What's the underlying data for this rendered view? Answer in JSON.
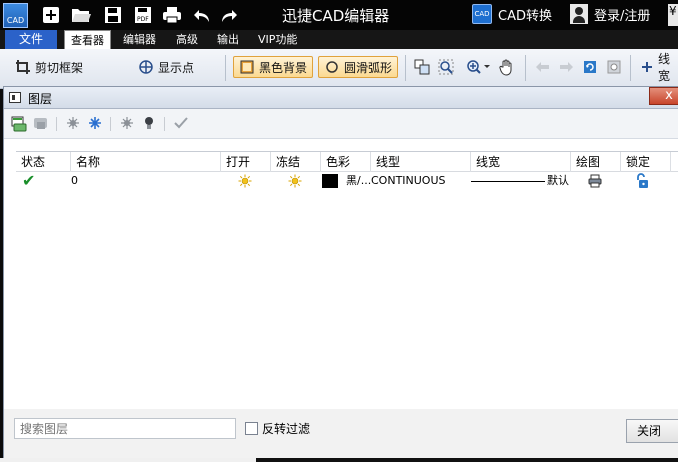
{
  "titlebar": {
    "logo": "CAD",
    "title": "迅捷CAD编辑器",
    "cad_convert_badge": "CAD",
    "cad_convert": "CAD转换",
    "login": "登录/注册",
    "yen": "¥"
  },
  "menu": {
    "file": "文件",
    "items": [
      "查看器",
      "编辑器",
      "高级",
      "输出",
      "VIP功能"
    ]
  },
  "ribbon": {
    "clip_frame": "剪切框架",
    "show_points": "显示点",
    "black_bg": "黑色背景",
    "smooth_arc": "圆滑弧形",
    "linewidth": "线宽"
  },
  "dialog": {
    "title": "图层",
    "close_x": "x",
    "columns": [
      "状态",
      "名称",
      "打开",
      "冻结",
      "色彩",
      "线型",
      "线宽",
      "绘图",
      "锁定"
    ],
    "rows": [
      {
        "status": "✔",
        "name": "0",
        "color_label": "黑/...",
        "linetype": "CONTINUOUS",
        "lineweight": "默认",
        "swatch_color": "#000000"
      }
    ],
    "search_placeholder": "搜索图层",
    "invert_filter": "反转过滤",
    "close_button": "关闭"
  },
  "colors": {
    "accent": "#2b62c9",
    "check": "#1a8f2a",
    "bulb": "#f2c21a",
    "lock": "#2a78c8"
  }
}
